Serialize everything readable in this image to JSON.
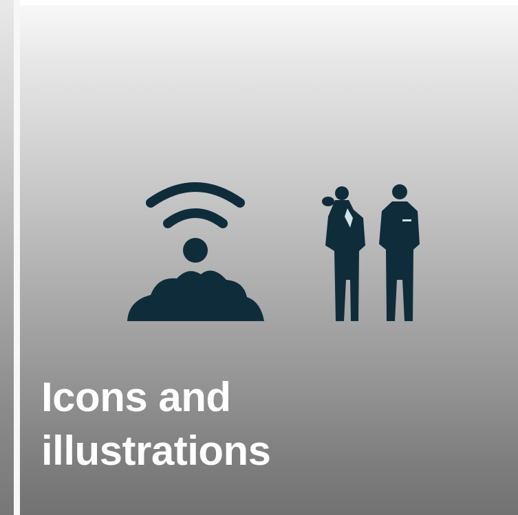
{
  "tile": {
    "title_line1": "Icons and",
    "title_line2": "illustrations"
  },
  "icons": {
    "signal": "wireless-signal-icon",
    "cloud": "cloud-icon",
    "people": "two-people-icon"
  },
  "colors": {
    "icon_fill": "#0f2c3a",
    "caption_text": "#ffffff",
    "divider": "#f7f7f7"
  }
}
